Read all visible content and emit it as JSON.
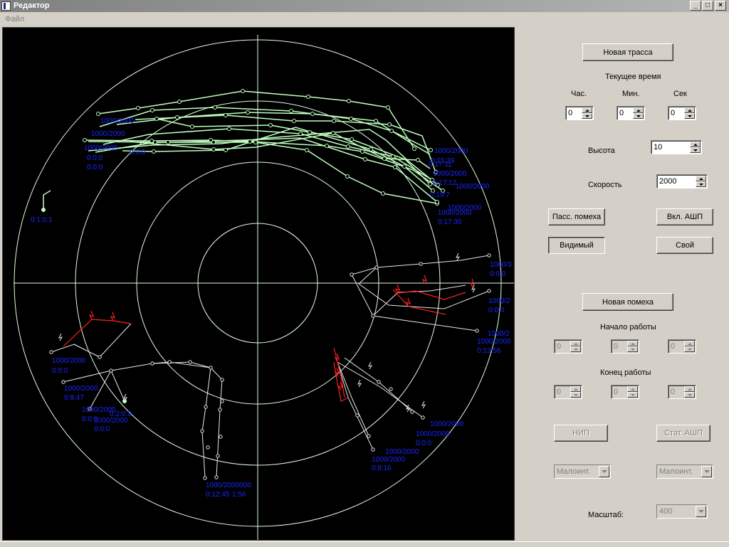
{
  "window": {
    "title": "Редактор",
    "minimize": "_",
    "maximize": "□",
    "close": "×"
  },
  "menu": {
    "file": "Файл"
  },
  "panel": {
    "new_track": "Новая трасса",
    "current_time": "Текущее время",
    "hour_label": "Час.",
    "min_label": "Мин.",
    "sec_label": "Сек",
    "hour_value": "0",
    "min_value": "0",
    "sec_value": "0",
    "height_label": "Высота",
    "height_value": "10",
    "speed_label": "Скорость",
    "speed_value": "2000",
    "passive_jam": "Пасс. помеха",
    "enable_ashp": "Вкл. АШП",
    "visible": "Видимый",
    "own": "Свой",
    "new_jam": "Новая помеха",
    "work_start": "Начало работы",
    "start_h": "0",
    "start_m": "0",
    "start_s": "0",
    "work_end": "Конец работы",
    "end_h": "0",
    "end_m": "0",
    "end_s": "0",
    "nip": "НИП",
    "stat_ashp": "Стат. АШП",
    "low_intensity_1": "Малоинт.",
    "low_intensity_2": "Малоинт.",
    "scale_label": "Масштаб:",
    "scale_value": "400"
  },
  "radar": {
    "colors": {
      "background": "#000000",
      "grid": "#dfffdf",
      "track_green": "#bfffbf",
      "track_white": "#e8e8e8",
      "jam_red": "#ff2020",
      "label": "#1a26ff"
    },
    "labels": [
      "1000/2000",
      "1000/2000",
      "1000/2000",
      "0:0:0",
      "0:0:0",
      "0:0:0",
      "1000/2000",
      "0:15:39",
      "0:17:11",
      "1000/2000",
      "0:17:12",
      "1000/2000",
      "0:19:7",
      "1000/2000",
      "1000/2000",
      "0:17:30",
      "0:1:0:1",
      "1000/3",
      "0:0:0",
      "1000/2",
      "0:0:0",
      "1000/2",
      "1000/2000",
      "0:13:56",
      "1000/2000",
      "0:0:0",
      "1000/2000",
      "0:8:47",
      "1000/2000",
      "0:0:0",
      "1000/2000",
      "0:0:0",
      "0:2:0:3",
      "1000/2000",
      "1000/2000",
      "0:0:0",
      "1000/2000",
      "1000/2000",
      "0:8:16",
      "1000/2000000",
      "0:12:45",
      "1:56"
    ]
  }
}
